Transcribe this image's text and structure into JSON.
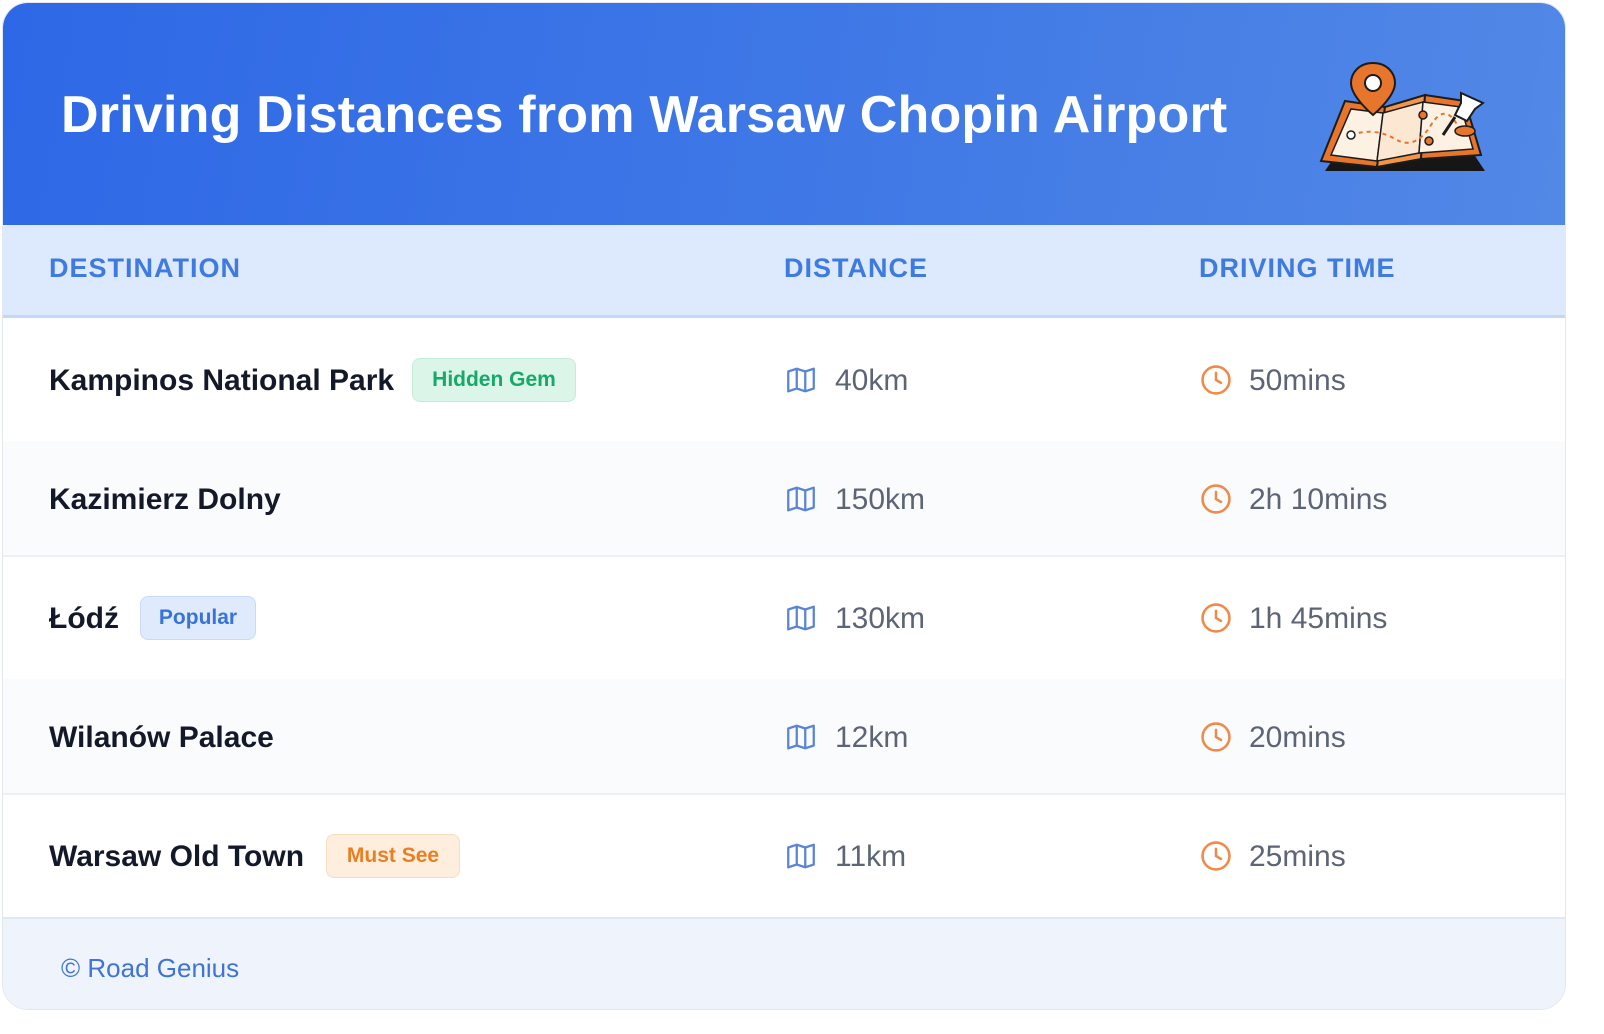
{
  "header": {
    "title": "Driving Distances from Warsaw Chopin Airport",
    "illustration_icon": "map-with-pin-icon"
  },
  "table": {
    "columns": [
      "DESTINATION",
      "DISTANCE",
      "DRIVING TIME"
    ],
    "rows": [
      {
        "destination": "Kampinos National Park",
        "badge": "Hidden Gem",
        "badge_color": "#17a86a",
        "distance": "40km",
        "time": "50mins"
      },
      {
        "destination": "Kazimierz Dolny",
        "badge": "",
        "distance": "150km",
        "time": "2h 10mins"
      },
      {
        "destination": "Łódź",
        "badge": "Popular",
        "badge_color": "#3874d8",
        "distance": "130km",
        "time": "1h 45mins"
      },
      {
        "destination": "Wilanów Palace",
        "badge": "",
        "distance": "12km",
        "time": "20mins"
      },
      {
        "destination": "Warsaw Old Town",
        "badge": "Must See",
        "badge_color": "#ea7f22",
        "distance": "11km",
        "time": "25mins"
      }
    ],
    "distance_icon": "map-icon",
    "time_icon": "clock-icon"
  },
  "footer": {
    "credit": "© Road Genius"
  },
  "colors": {
    "header_start": "#2e68e6",
    "header_end": "#5288e6",
    "accent": "#3e7ae0",
    "clock": "#ee8a4a"
  }
}
